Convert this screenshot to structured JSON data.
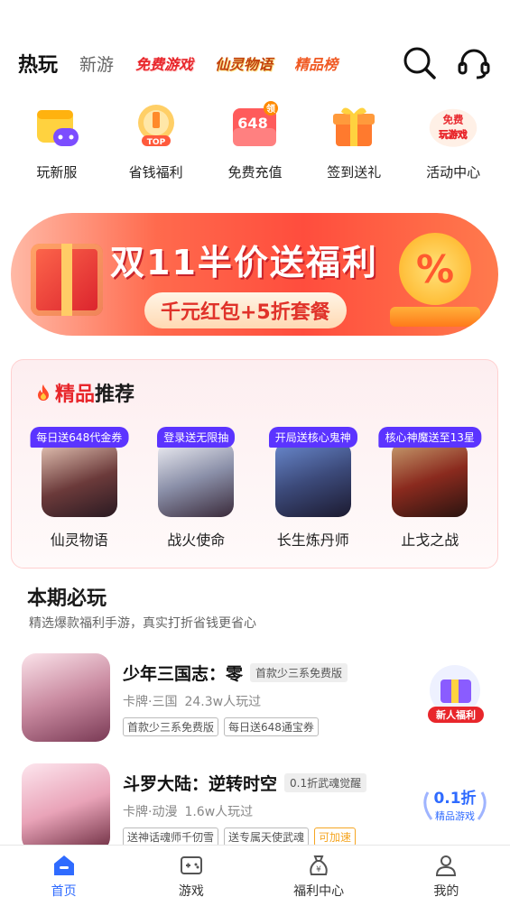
{
  "top_tabs": {
    "hot": "热玩",
    "new": "新游",
    "free_games": "免费游戏",
    "xianling": "仙灵物语",
    "top_list": "精品榜"
  },
  "quick_entries": [
    {
      "label": "玩新服",
      "icon": "gamepad-calendar-icon"
    },
    {
      "label": "省钱福利",
      "icon": "top-medal-icon"
    },
    {
      "label": "免费充值",
      "icon": "recharge-648-icon",
      "badge": "648",
      "corner": "领"
    },
    {
      "label": "签到送礼",
      "icon": "gift-box-icon"
    },
    {
      "label": "活动中心",
      "icon": "free-play-icon",
      "art_text": "免费玩游戏"
    }
  ],
  "banner": {
    "title": "双11半价送福利",
    "subtitle": "千元红包+5折套餐",
    "symbol": "%"
  },
  "recommended": {
    "title_highlight": "精品",
    "title_rest": "推荐",
    "games": [
      {
        "name": "仙灵物语",
        "badge": "每日送648代金券",
        "color": "#6b3a3a"
      },
      {
        "name": "战火使命",
        "badge": "登录送无限抽",
        "color": "#8a8fa8"
      },
      {
        "name": "长生炼丹师",
        "badge": "开局送核心鬼神",
        "color": "#3c4a7a"
      },
      {
        "name": "止戈之战",
        "badge": "核心神魔送至13星",
        "color": "#8a2a1e"
      }
    ]
  },
  "must_play": {
    "title": "本期必玩",
    "subtitle": "精选爆款福利手游，真实打折省钱更省心",
    "games": [
      {
        "name": "少年三国志：零",
        "tag": "首款少三系免费版",
        "genre": "卡牌·三国",
        "players": "24.3w人玩过",
        "tags": [
          "首款少三系免费版",
          "每日送648通宝券"
        ],
        "side": "新人福利"
      },
      {
        "name": "斗罗大陆：逆转时空",
        "tag": "0.1折武魂觉醒",
        "genre": "卡牌·动漫",
        "players": "1.6w人玩过",
        "tags": [
          "送神话魂师千仞雪",
          "送专属天使武魂"
        ],
        "tag_orange": "可加速",
        "side_value": "0.1折",
        "side_label": "精品游戏"
      }
    ]
  },
  "tabbar": [
    {
      "label": "首页",
      "icon": "home-icon",
      "active": true
    },
    {
      "label": "游戏",
      "icon": "game-icon"
    },
    {
      "label": "福利中心",
      "icon": "money-bag-icon"
    },
    {
      "label": "我的",
      "icon": "profile-icon"
    }
  ],
  "colors": {
    "accent_blue": "#2f6bff",
    "brand_red": "#e8262b",
    "badge_purple": "#5b34ff"
  }
}
